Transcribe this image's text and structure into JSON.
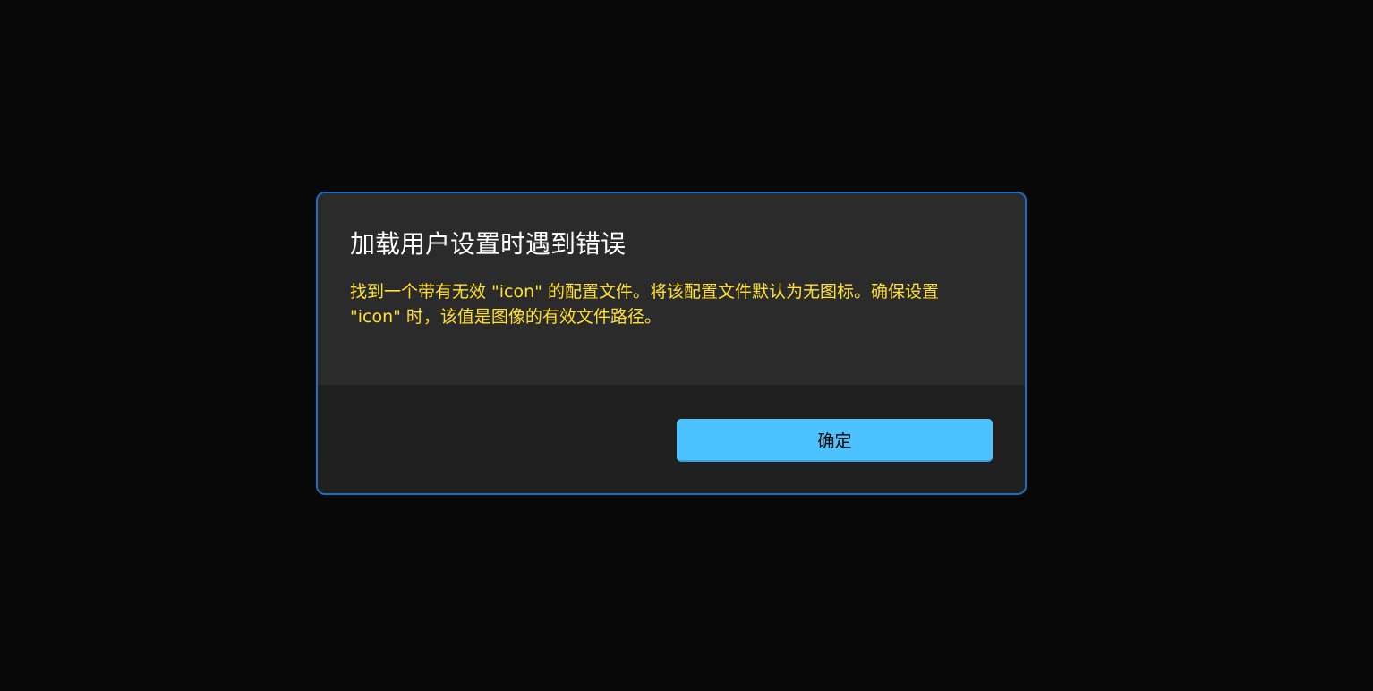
{
  "dialog": {
    "title": "加载用户设置时遇到错误",
    "message": "找到一个带有无效 \"icon\" 的配置文件。将该配置文件默认为无图标。确保设置 \"icon\" 时，该值是图像的有效文件路径。",
    "primary_button_label": "确定"
  },
  "colors": {
    "background": "#080808",
    "dialog_border": "#1a6fc0",
    "content_background": "#2b2b2b",
    "footer_background": "#202020",
    "message_text": "#ffe033",
    "accent_button": "#4cc2ff"
  }
}
